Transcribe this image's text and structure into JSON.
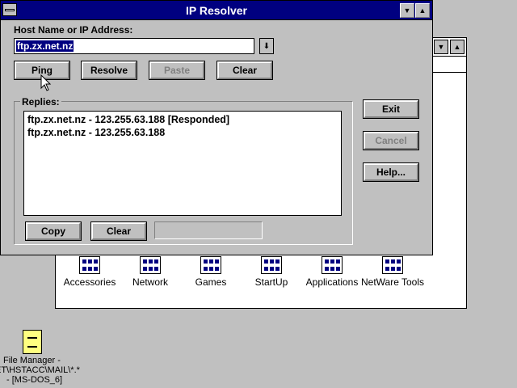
{
  "dialog": {
    "title": "IP Resolver",
    "host_label": "Host Name or IP Address:",
    "host_value": "ftp.zx.net.nz",
    "buttons": {
      "ping": "Ping",
      "resolve": "Resolve",
      "paste": "Paste",
      "clear": "Clear",
      "exit": "Exit",
      "cancel": "Cancel",
      "help": "Help..."
    },
    "replies_label": "Replies:",
    "replies": [
      "ftp.zx.net.nz - 123.255.63.188 [Responded]",
      "ftp.zx.net.nz - 123.255.63.188"
    ],
    "reply_buttons": {
      "copy": "Copy",
      "clear": "Clear"
    },
    "status_text": ""
  },
  "program_groups": [
    {
      "label": "Accessories"
    },
    {
      "label": "Network"
    },
    {
      "label": "Games"
    },
    {
      "label": "StartUp"
    },
    {
      "label": "Applications"
    },
    {
      "label": "NetWare Tools"
    }
  ],
  "desktop_icon": {
    "lines": [
      "File Manager -",
      "ET\\HSTACC\\MAIL\\*.*",
      "- [MS-DOS_6]"
    ]
  },
  "colors": {
    "title_bar": "#000080",
    "desktop": "#c0c0c0",
    "selection": "#000080"
  }
}
